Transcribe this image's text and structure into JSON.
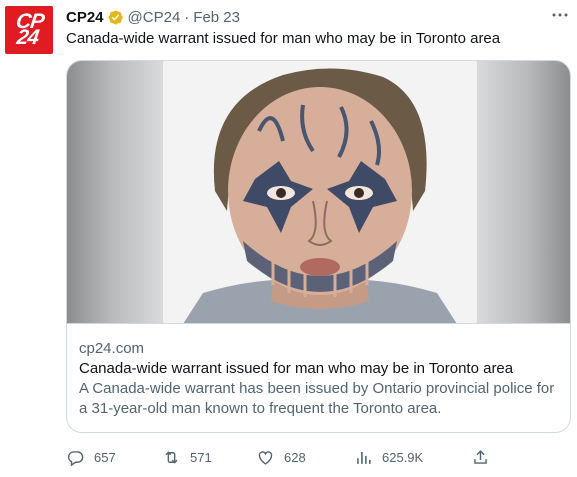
{
  "tweet": {
    "avatar_text_top": "CP",
    "avatar_text_bottom": "24",
    "display_name": "CP24",
    "handle": "@CP24",
    "separator": "·",
    "date": "Feb 23",
    "text": "Canada-wide warrant issued for man who may be in Toronto area"
  },
  "card": {
    "domain": "cp24.com",
    "title": "Canada-wide warrant issued for man who may be in Toronto area",
    "description": "A Canada-wide warrant has been issued by Ontario provincial police for a 31-year-old man known to frequent the Toronto area."
  },
  "actions": {
    "replies": "657",
    "retweets": "571",
    "likes": "628",
    "views": "625.9K"
  },
  "icons": {
    "verified": "verified-badge-icon",
    "more": "more-icon",
    "reply": "reply-icon",
    "retweet": "retweet-icon",
    "like": "heart-icon",
    "views": "views-icon",
    "share": "share-icon"
  },
  "colors": {
    "brand_red": "#e11b22",
    "verified_gold": "#e2b719",
    "secondary_text": "#536471",
    "primary_text": "#0f1419",
    "border": "#cfd9de"
  }
}
